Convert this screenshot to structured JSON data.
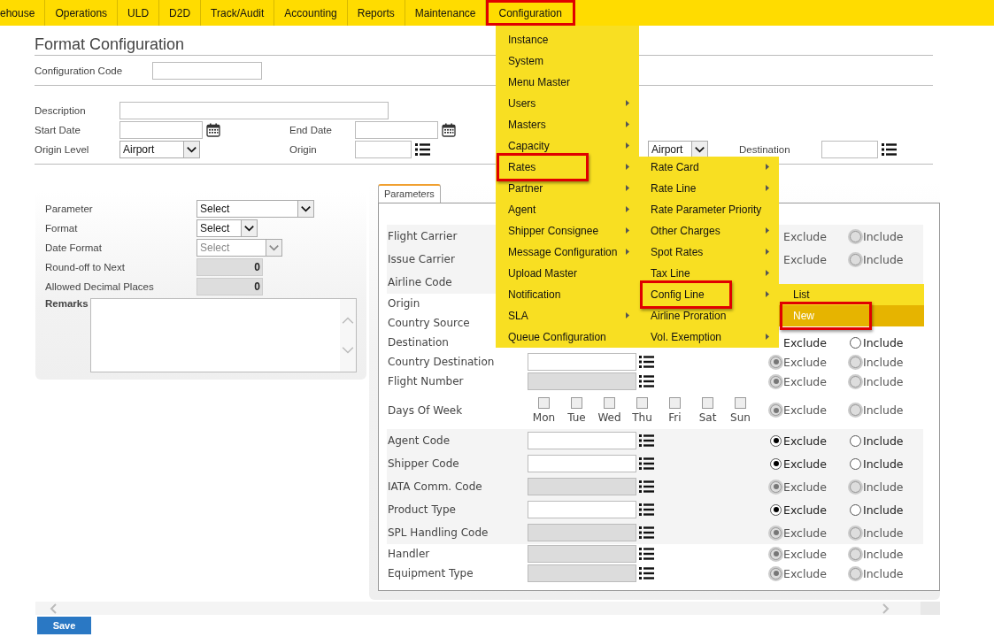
{
  "nav": [
    {
      "label": "ehouse",
      "selected": false,
      "outlined": false
    },
    {
      "label": "Operations",
      "selected": false,
      "outlined": false
    },
    {
      "label": "ULD",
      "selected": false,
      "outlined": false
    },
    {
      "label": "D2D",
      "selected": false,
      "outlined": false
    },
    {
      "label": "Track/Audit",
      "selected": false,
      "outlined": false
    },
    {
      "label": "Accounting",
      "selected": false,
      "outlined": false
    },
    {
      "label": "Reports",
      "selected": false,
      "outlined": false
    },
    {
      "label": "Maintenance",
      "selected": false,
      "outlined": false
    },
    {
      "label": "Configuration",
      "selected": true,
      "outlined": true
    }
  ],
  "menu": {
    "items": [
      {
        "label": "Instance",
        "arrow": false,
        "selected": false,
        "outlined": false
      },
      {
        "label": "System",
        "arrow": false,
        "selected": false,
        "outlined": false
      },
      {
        "label": "Menu Master",
        "arrow": false,
        "selected": false,
        "outlined": false
      },
      {
        "label": "Users",
        "arrow": true,
        "selected": false,
        "outlined": false
      },
      {
        "label": "Masters",
        "arrow": true,
        "selected": false,
        "outlined": false
      },
      {
        "label": "Capacity",
        "arrow": true,
        "selected": false,
        "outlined": false
      },
      {
        "label": "Rates",
        "arrow": true,
        "selected": false,
        "outlined": true,
        "submenu": [
          {
            "label": "Rate Card",
            "arrow": true,
            "selected": false,
            "outlined": false
          },
          {
            "label": "Rate Line",
            "arrow": true,
            "selected": false,
            "outlined": false
          },
          {
            "label": "Rate Parameter Priority",
            "arrow": false,
            "selected": false,
            "outlined": false
          },
          {
            "label": "Other Charges",
            "arrow": true,
            "selected": false,
            "outlined": false
          },
          {
            "label": "Spot Rates",
            "arrow": true,
            "selected": false,
            "outlined": false
          },
          {
            "label": "Tax Line",
            "arrow": true,
            "selected": false,
            "outlined": false
          },
          {
            "label": "Config Line",
            "arrow": true,
            "selected": false,
            "outlined": true,
            "submenu": [
              {
                "label": "List",
                "arrow": false,
                "selected": false,
                "outlined": false
              },
              {
                "label": "New",
                "arrow": false,
                "selected": true,
                "outlined": true
              }
            ]
          },
          {
            "label": "Airline Proration",
            "arrow": false,
            "selected": false,
            "outlined": false
          },
          {
            "label": "Vol. Exemption",
            "arrow": true,
            "selected": false,
            "outlined": false
          }
        ]
      },
      {
        "label": "Partner",
        "arrow": true,
        "selected": false,
        "outlined": false
      },
      {
        "label": "Agent",
        "arrow": true,
        "selected": false,
        "outlined": false
      },
      {
        "label": "Shipper Consignee",
        "arrow": true,
        "selected": false,
        "outlined": false
      },
      {
        "label": "Message Configuration",
        "arrow": true,
        "selected": false,
        "outlined": false
      },
      {
        "label": "Upload Master",
        "arrow": false,
        "selected": false,
        "outlined": false
      },
      {
        "label": "Notification",
        "arrow": false,
        "selected": false,
        "outlined": false
      },
      {
        "label": "SLA",
        "arrow": true,
        "selected": false,
        "outlined": false
      },
      {
        "label": "Queue Configuration",
        "arrow": false,
        "selected": false,
        "outlined": false
      }
    ]
  },
  "title": "Format Configuration",
  "config_code": {
    "label": "Configuration Code"
  },
  "header": {
    "description": {
      "label": "Description"
    },
    "start_date": {
      "label": "Start Date"
    },
    "end_date": {
      "label": "End Date"
    },
    "origin_level": {
      "label": "Origin Level",
      "value": "Airport"
    },
    "origin": {
      "label": "Origin"
    },
    "destination_level": {
      "value": "Airport"
    },
    "destination": {
      "label": "Destination"
    }
  },
  "left_panel": {
    "fields": [
      {
        "label": "Parameter",
        "kind": "select",
        "value": "Select",
        "disabled": false
      },
      {
        "label": "Format",
        "kind": "select",
        "value": "Select",
        "disabled": false
      },
      {
        "label": "Date Format",
        "kind": "select",
        "value": "Select",
        "disabled": true
      },
      {
        "label": "Round-off to Next",
        "kind": "number",
        "value": "0"
      },
      {
        "label": "Allowed Decimal Places",
        "kind": "number",
        "value": "0"
      },
      {
        "label": "Remarks",
        "kind": "textarea"
      }
    ]
  },
  "params": {
    "tab": {
      "label": "Parameters",
      "selected": true
    },
    "rows": [
      {
        "kind": "field",
        "label": "Flight Carrier",
        "shaded": true,
        "radios_disabled": true,
        "exclude": {
          "label": "Exclude"
        },
        "include": {
          "label": "Include",
          "selected": false
        }
      },
      {
        "kind": "field",
        "label": "Issue Carrier",
        "shaded": true,
        "radios_disabled": true,
        "exclude": {
          "label": "Exclude"
        },
        "include": {
          "label": "Include",
          "selected": false
        }
      },
      {
        "kind": "field",
        "label": "Airline Code",
        "shaded": true
      },
      {
        "kind": "field",
        "label": "Origin",
        "shaded": false
      },
      {
        "kind": "field",
        "label": "Country Source",
        "shaded": false
      },
      {
        "kind": "field",
        "label": "Destination",
        "shaded": false,
        "radios_disabled": false,
        "exclude": {
          "label": "Exclude"
        },
        "include": {
          "label": "Include",
          "selected": false
        }
      },
      {
        "kind": "field",
        "label": "Country Destination",
        "shaded": false,
        "field": {
          "disabled": false
        },
        "list_button": true,
        "radios_disabled": true,
        "exclude": {
          "label": "Exclude",
          "selected": true
        },
        "include": {
          "label": "Include",
          "selected": false
        }
      },
      {
        "kind": "field",
        "label": "Flight Number",
        "shaded": false,
        "field": {
          "disabled": true
        },
        "list_button": true,
        "radios_disabled": true,
        "exclude": {
          "label": "Exclude",
          "selected": true
        },
        "include": {
          "label": "Include",
          "selected": false
        }
      },
      {
        "kind": "days",
        "label": "Days Of Week",
        "shaded": false,
        "radios_disabled": true,
        "days": [
          {
            "label": "Mon",
            "checked": false
          },
          {
            "label": "Tue",
            "checked": false
          },
          {
            "label": "Wed",
            "checked": false
          },
          {
            "label": "Thu",
            "checked": false
          },
          {
            "label": "Fri",
            "checked": false
          },
          {
            "label": "Sat",
            "checked": false
          },
          {
            "label": "Sun",
            "checked": false
          }
        ],
        "exclude": {
          "label": "Exclude",
          "selected": true
        },
        "include": {
          "label": "Include",
          "selected": false
        }
      },
      {
        "kind": "field",
        "label": "Agent Code",
        "shaded": true,
        "field": {
          "disabled": false
        },
        "list_button": true,
        "radios_disabled": false,
        "exclude": {
          "label": "Exclude",
          "selected": true
        },
        "include": {
          "label": "Include",
          "selected": false
        }
      },
      {
        "kind": "field",
        "label": "Shipper Code",
        "shaded": true,
        "field": {
          "disabled": false
        },
        "list_button": true,
        "radios_disabled": false,
        "exclude": {
          "label": "Exclude",
          "selected": true
        },
        "include": {
          "label": "Include",
          "selected": false
        }
      },
      {
        "kind": "field",
        "label": "IATA Comm. Code",
        "shaded": true,
        "field": {
          "disabled": true
        },
        "list_button": true,
        "radios_disabled": true,
        "exclude": {
          "label": "Exclude",
          "selected": true
        },
        "include": {
          "label": "Include",
          "selected": false
        }
      },
      {
        "kind": "field",
        "label": "Product Type",
        "shaded": true,
        "field": {
          "disabled": false
        },
        "list_button": true,
        "radios_disabled": false,
        "exclude": {
          "label": "Exclude",
          "selected": true
        },
        "include": {
          "label": "Include",
          "selected": false
        }
      },
      {
        "kind": "field",
        "label": "SPL Handling Code",
        "shaded": true,
        "field": {
          "disabled": true
        },
        "list_button": true,
        "radios_disabled": true,
        "exclude": {
          "label": "Exclude",
          "selected": true
        },
        "include": {
          "label": "Include",
          "selected": false
        }
      },
      {
        "kind": "field",
        "label": "Handler",
        "shaded": false,
        "field": {
          "disabled": true
        },
        "list_button": true,
        "radios_disabled": true,
        "exclude": {
          "label": "Exclude",
          "selected": true
        },
        "include": {
          "label": "Include",
          "selected": false
        }
      },
      {
        "kind": "field",
        "label": "Equipment Type",
        "shaded": false,
        "field": {
          "disabled": true
        },
        "list_button": true,
        "radios_disabled": true,
        "exclude": {
          "label": "Exclude",
          "selected": true
        },
        "include": {
          "label": "Include",
          "selected": false
        }
      }
    ]
  },
  "save_button": {
    "label": "Save"
  }
}
